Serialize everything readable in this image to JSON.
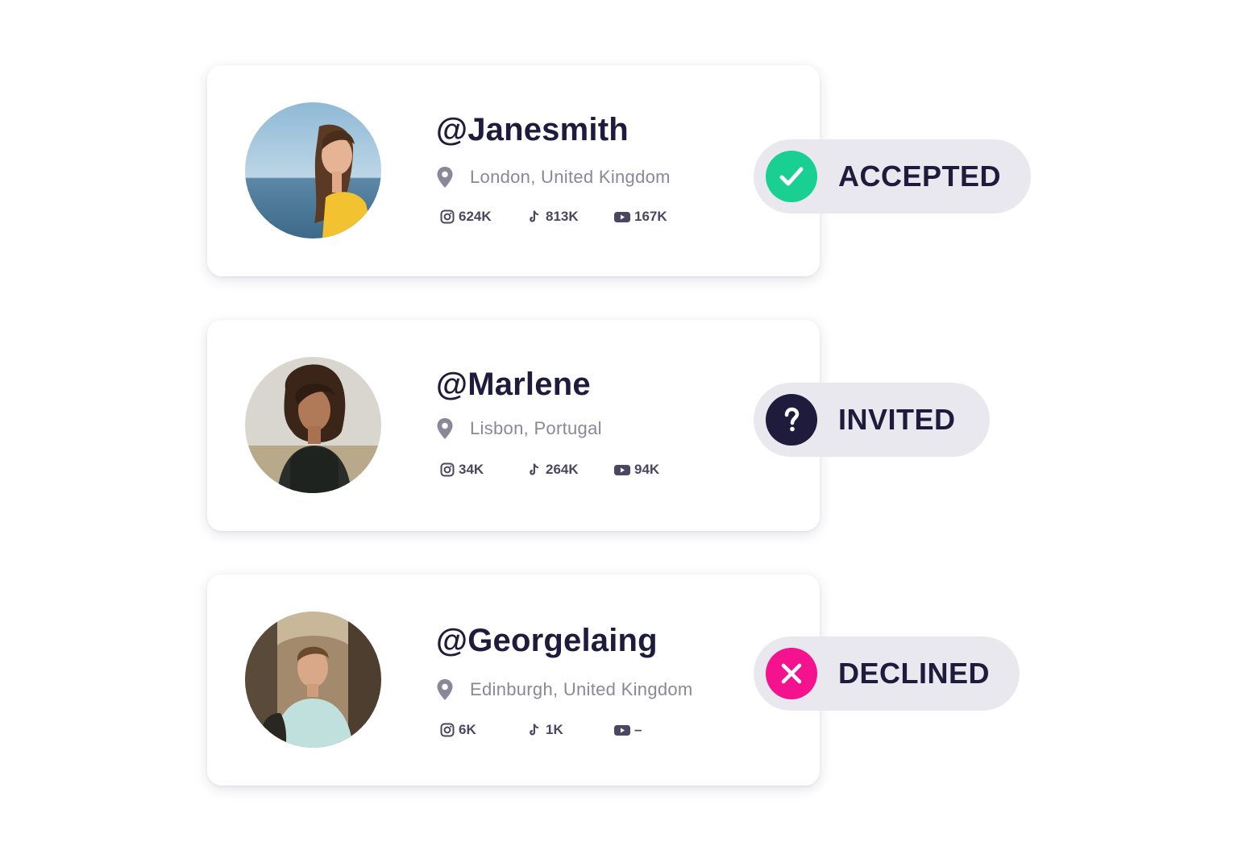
{
  "colors": {
    "handle_text": "#1f1b3d",
    "location_text": "#8a8799",
    "stat_text": "#4a4760",
    "pill_bg": "#e9e8ee",
    "accepted": "#19d092",
    "invited": "#1f1b3d",
    "declined": "#f5128f"
  },
  "influencers": [
    {
      "handle": "@Janesmith",
      "location": "London, United Kingdom",
      "instagram": "624K",
      "tiktok": "813K",
      "youtube": "167K",
      "status": {
        "label": "ACCEPTED",
        "icon": "check-icon",
        "color": "#19d092"
      }
    },
    {
      "handle": "@Marlene",
      "location": "Lisbon, Portugal",
      "instagram": "34K",
      "tiktok": "264K",
      "youtube": "94K",
      "status": {
        "label": "INVITED",
        "icon": "question-icon",
        "color": "#1f1b3d"
      }
    },
    {
      "handle": "@Georgelaing",
      "location": "Edinburgh, United Kingdom",
      "instagram": "6K",
      "tiktok": "1K",
      "youtube": "–",
      "status": {
        "label": "DECLINED",
        "icon": "close-icon",
        "color": "#f5128f"
      }
    }
  ]
}
